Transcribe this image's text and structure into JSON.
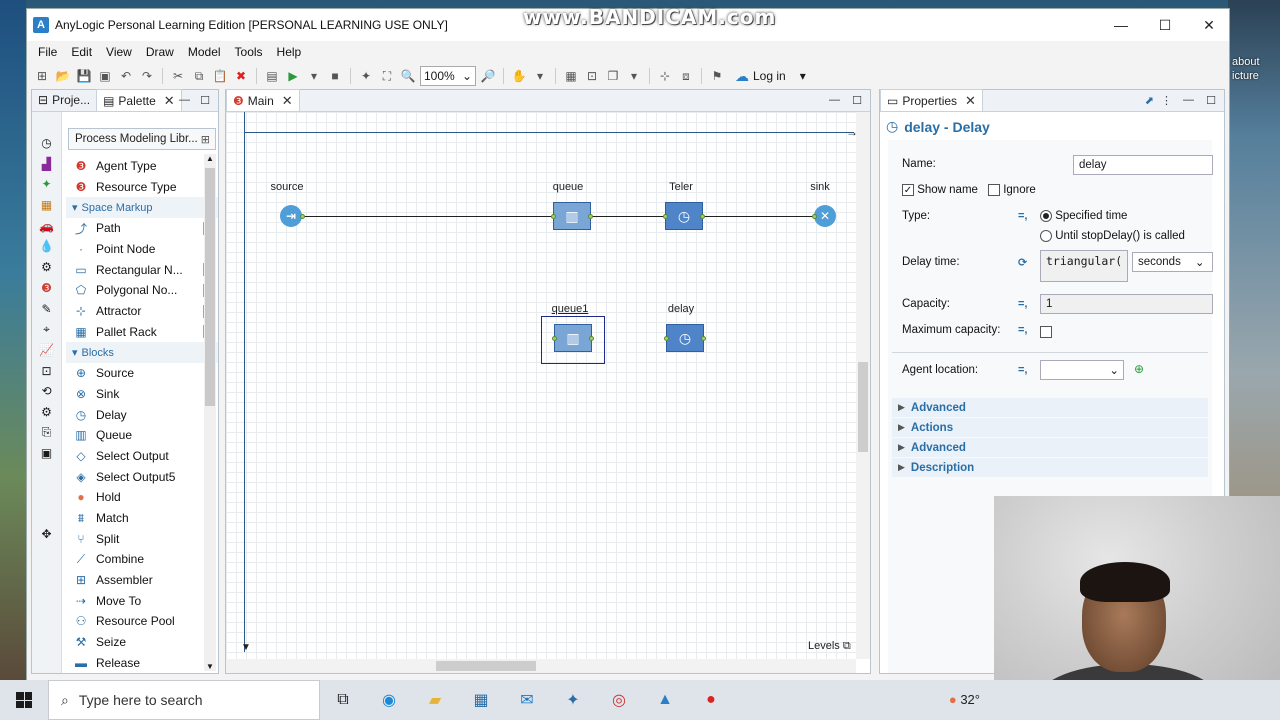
{
  "window": {
    "title": "AnyLogic Personal Learning Edition [PERSONAL LEARNING USE ONLY]",
    "watermark": "www.BANDICAM.com",
    "controls": {
      "minimize": "—",
      "maximize": "☐",
      "close": "✕"
    }
  },
  "menu": [
    "File",
    "Edit",
    "View",
    "Draw",
    "Model",
    "Tools",
    "Help"
  ],
  "toolbar": {
    "zoom": "100%",
    "login": "Log in"
  },
  "left_tabs": {
    "project": "Proje...",
    "palette": "Palette"
  },
  "palette": {
    "library": "Process Modeling Libr...",
    "items": [
      {
        "type": "item",
        "label": "Agent Type",
        "icon": "agent-icon",
        "glyph": "❸",
        "color": "#d23b2f",
        "pen": false
      },
      {
        "type": "item",
        "label": "Resource Type",
        "icon": "resource-type-icon",
        "glyph": "❸",
        "color": "#d23b2f",
        "pen": false
      },
      {
        "type": "group",
        "label": "Space Markup"
      },
      {
        "type": "item",
        "label": "Path",
        "icon": "path-icon",
        "glyph": "⤴",
        "color": "#2a6ea6",
        "pen": true
      },
      {
        "type": "item",
        "label": "Point Node",
        "icon": "point-node-icon",
        "glyph": "·",
        "color": "#2a6ea6",
        "pen": false
      },
      {
        "type": "item",
        "label": "Rectangular N...",
        "icon": "rect-node-icon",
        "glyph": "▭",
        "color": "#2a6ea6",
        "pen": true
      },
      {
        "type": "item",
        "label": "Polygonal No...",
        "icon": "polygon-node-icon",
        "glyph": "⬠",
        "color": "#2a6ea6",
        "pen": true
      },
      {
        "type": "item",
        "label": "Attractor",
        "icon": "attractor-icon",
        "glyph": "⊹",
        "color": "#2a6ea6",
        "pen": true
      },
      {
        "type": "item",
        "label": "Pallet Rack",
        "icon": "pallet-rack-icon",
        "glyph": "▦",
        "color": "#2a6ea6",
        "pen": true
      },
      {
        "type": "group",
        "label": "Blocks"
      },
      {
        "type": "item",
        "label": "Source",
        "icon": "source-icon",
        "glyph": "⊕",
        "color": "#2a6ea6",
        "pen": false
      },
      {
        "type": "item",
        "label": "Sink",
        "icon": "sink-icon",
        "glyph": "⊗",
        "color": "#2a6ea6",
        "pen": false
      },
      {
        "type": "item",
        "label": "Delay",
        "icon": "delay-icon",
        "glyph": "◷",
        "color": "#2a6ea6",
        "pen": false
      },
      {
        "type": "item",
        "label": "Queue",
        "icon": "queue-icon",
        "glyph": "▥",
        "color": "#2a6ea6",
        "pen": false
      },
      {
        "type": "item",
        "label": "Select Output",
        "icon": "select-output-icon",
        "glyph": "◇",
        "color": "#2a6ea6",
        "pen": false
      },
      {
        "type": "item",
        "label": "Select Output5",
        "icon": "select-output5-icon",
        "glyph": "◈",
        "color": "#2a6ea6",
        "pen": false
      },
      {
        "type": "item",
        "label": "Hold",
        "icon": "hold-icon",
        "glyph": "●",
        "color": "#e0704a",
        "pen": false
      },
      {
        "type": "item",
        "label": "Match",
        "icon": "match-icon",
        "glyph": "⩩",
        "color": "#2a6ea6",
        "pen": false
      },
      {
        "type": "item",
        "label": "Split",
        "icon": "split-icon",
        "glyph": "⑂",
        "color": "#2a6ea6",
        "pen": false
      },
      {
        "type": "item",
        "label": "Combine",
        "icon": "combine-icon",
        "glyph": "⟋",
        "color": "#2a6ea6",
        "pen": false
      },
      {
        "type": "item",
        "label": "Assembler",
        "icon": "assembler-icon",
        "glyph": "⊞",
        "color": "#2a6ea6",
        "pen": false
      },
      {
        "type": "item",
        "label": "Move To",
        "icon": "move-to-icon",
        "glyph": "⇢",
        "color": "#2a6ea6",
        "pen": false
      },
      {
        "type": "item",
        "label": "Resource Pool",
        "icon": "resource-pool-icon",
        "glyph": "⚇",
        "color": "#2a6ea6",
        "pen": false
      },
      {
        "type": "item",
        "label": "Seize",
        "icon": "seize-icon",
        "glyph": "⚒",
        "color": "#2a6ea6",
        "pen": false
      },
      {
        "type": "item",
        "label": "Release",
        "icon": "release-icon",
        "glyph": "▬",
        "color": "#2a6ea6",
        "pen": false
      }
    ]
  },
  "editor": {
    "tab": "Main",
    "nodes": {
      "source": "source",
      "queue": "queue",
      "teler": "Teler",
      "sink": "sink",
      "queue1": "queue1",
      "delay": "delay"
    },
    "levels": "Levels"
  },
  "properties": {
    "tab": "Properties",
    "title": "delay - Delay",
    "name_label": "Name:",
    "name_value": "delay",
    "show_name": "Show name",
    "ignore": "Ignore",
    "type_label": "Type:",
    "type_opt1": "Specified time",
    "type_opt2": "Until stopDelay() is called",
    "delay_label": "Delay time:",
    "delay_value": "triangular(",
    "delay_unit": "seconds",
    "capacity_label": "Capacity:",
    "capacity_value": "1",
    "maxcap_label": "Maximum capacity:",
    "agent_location_label": "Agent location:",
    "sections": [
      "Advanced",
      "Actions",
      "Advanced",
      "Description"
    ]
  },
  "taskbar": {
    "search_placeholder": "Type here to search",
    "temperature": "32°"
  },
  "desktop": {
    "right_text": "about",
    "right_text2": "icture"
  }
}
